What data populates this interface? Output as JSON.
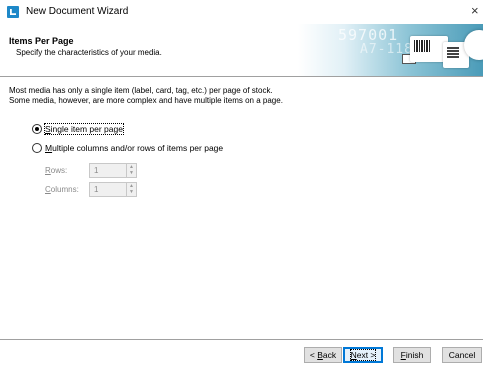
{
  "window": {
    "title": "New Document Wizard",
    "close_glyph": "×",
    "icon": "wizard-app-icon"
  },
  "header": {
    "title": "Items Per Page",
    "subtitle": "Specify the characteristics of your media.",
    "banner_text_1": "597001",
    "banner_text_2": "A7-118"
  },
  "description": {
    "line1": "Most media has only a single item (label, card, tag, etc.) per page of stock.",
    "line2": "Some media, however, are more complex and have multiple items on a page."
  },
  "options": {
    "single": {
      "mnemonic": "S",
      "rest": "ingle item per page",
      "checked": true
    },
    "multiple": {
      "mnemonic": "M",
      "rest": "ultiple columns and/or rows of items per page",
      "checked": false
    }
  },
  "rows_field": {
    "mnemonic": "R",
    "rest": "ows:",
    "value": "1",
    "enabled": false
  },
  "columns_field": {
    "mnemonic": "C",
    "rest": "olumns:",
    "value": "1",
    "enabled": false
  },
  "buttons": {
    "back": {
      "prefix": "< ",
      "mnemonic": "B",
      "rest": "ack"
    },
    "next": {
      "mnemonic": "N",
      "rest": "ext >"
    },
    "finish": {
      "mnemonic": "F",
      "rest": "inish"
    },
    "cancel": "Cancel"
  },
  "colors": {
    "accent": "#0078d7",
    "banner_dark": "#4a9bb8",
    "disabled_text": "#8a8a8a"
  }
}
